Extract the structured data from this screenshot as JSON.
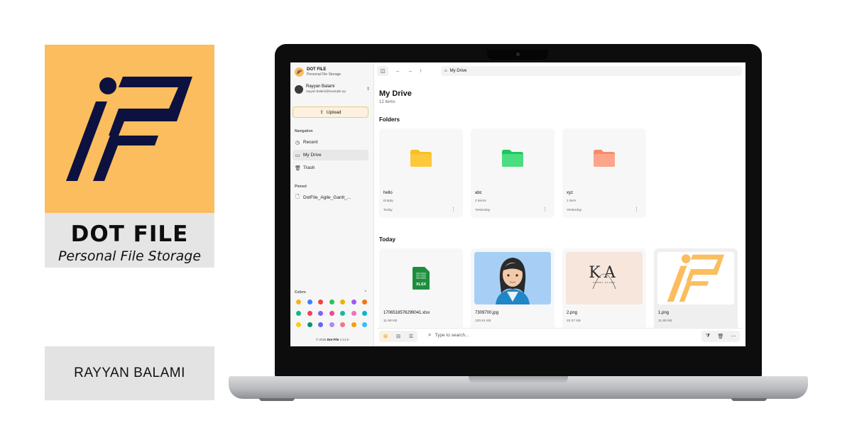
{
  "promo": {
    "brand_title": "DOT FILE",
    "brand_subtitle": "Personal File Storage",
    "author": "RAYYAN BALAMI",
    "brand_color": "#fbbd5d",
    "logo_ink": "#0c1140"
  },
  "app": {
    "name": "DOT FILE",
    "tagline": "Personal File Storage",
    "user": {
      "name": "Rayyan Balami",
      "email": "rayyan.balami@example.np"
    },
    "upload_label": "Upload",
    "navigation_heading": "Navigation",
    "nav": [
      {
        "label": "Recent",
        "icon": "clock-icon"
      },
      {
        "label": "My Drive",
        "icon": "folder-icon",
        "active": true
      },
      {
        "label": "Trash",
        "icon": "trash-icon"
      }
    ],
    "pinned_heading": "Pinned",
    "pinned": [
      {
        "label": "DotFile_Agile_Gantt_...",
        "icon": "file-icon"
      }
    ],
    "colors_heading": "Colors",
    "swatches": [
      "#f5b323",
      "#3b82f6",
      "#ef4444",
      "#22c55e",
      "#eab308",
      "#a855f7",
      "#f97316",
      "#10b981",
      "#f43f5e",
      "#8b5cf6",
      "#ec4899",
      "#14b8a6",
      "#f472b6",
      "#06b6d4",
      "#facc15",
      "#059669",
      "#6366f1",
      "#a78bfa",
      "#fb7185",
      "#f59e0b",
      "#38bdf8"
    ],
    "copyright": {
      "prefix": "© 2025",
      "brand": "Dot File",
      "version": "2.14.9"
    },
    "breadcrumb": "My Drive",
    "page_title": "My Drive",
    "item_count": "12 items",
    "folders_heading": "Folders",
    "folders": [
      {
        "name": "hello",
        "meta": "Empty",
        "date": "Today",
        "color": "#fbbf24"
      },
      {
        "name": "abc",
        "meta": "2 items",
        "date": "Yesterday",
        "color": "#4ade80"
      },
      {
        "name": "xyz",
        "meta": "1 item",
        "date": "Yesterday",
        "color": "#fca5a5"
      }
    ],
    "today_heading": "Today",
    "files": [
      {
        "name": "1706518576299041.xlsx",
        "size": "11.98 KB",
        "badge": "XLSX"
      },
      {
        "name": "7309700.jpg",
        "size": "130.61 KB"
      },
      {
        "name": "2.png",
        "size": "20.37 KB",
        "monogram": "KA",
        "caption": "KERRY ALLEN"
      },
      {
        "name": "1.png",
        "size": "11.95 KB"
      }
    ],
    "search_placeholder": "Type to search..."
  }
}
